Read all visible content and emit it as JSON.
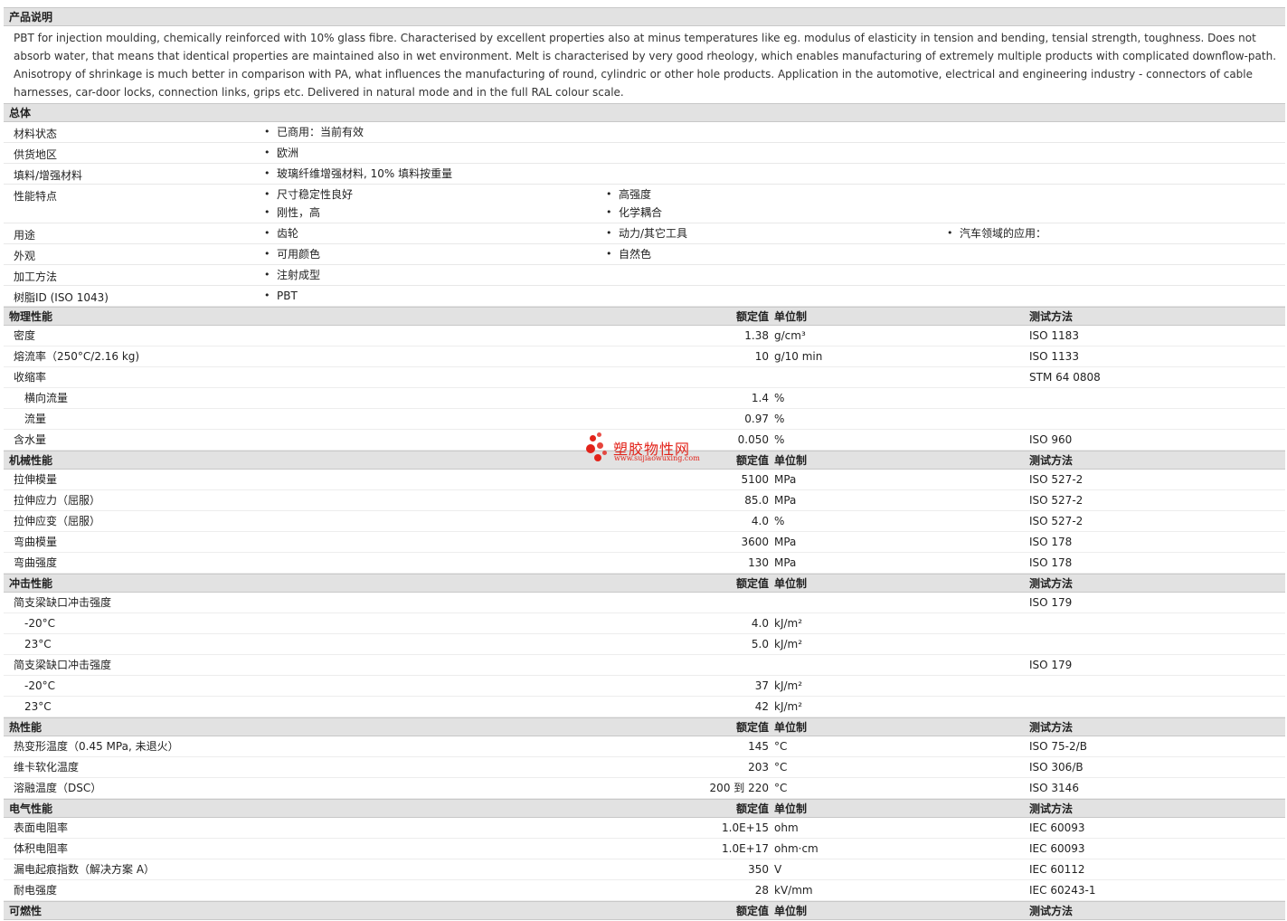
{
  "sections": {
    "desc_title": "产品说明",
    "general": "总体",
    "physical": "物理性能",
    "mechanical": "机械性能",
    "impact": "冲击性能",
    "thermal": "热性能",
    "electrical": "电气性能",
    "cut_off_next": "可燃性"
  },
  "headers": {
    "value": "额定值",
    "unit": "单位制",
    "test": "测试方法"
  },
  "description": "PBT for injection moulding, chemically reinforced with 10% glass fibre. Characterised by excellent properties also at minus temperatures like eg. modulus of elasticity in tension and bending, tensial strength, toughness. Does not absorb water, that means that identical properties are maintained also in wet environment. Melt is characterised by very good rheology, which enables manufacturing of extremely multiple products with complicated downflow-path. Anisotropy of shrinkage is much better in comparison with PA, what influences the manufacturing of round, cylindric or other hole products. Application in the automotive, electrical and engineering industry - connectors of cable harnesses, car-door locks, connection links, grips etc. Delivered in natural mode and in the full RAL colour scale.",
  "general": {
    "status": {
      "label": "材料状态",
      "items": [
        "已商用：当前有效"
      ]
    },
    "region": {
      "label": "供货地区",
      "items": [
        "欧洲"
      ]
    },
    "filler": {
      "label": "填料/增强材料",
      "items": [
        "玻璃纤维增强材料, 10% 填料按重量"
      ]
    },
    "features": {
      "label": "性能特点",
      "items": [
        "尺寸稳定性良好",
        "高强度",
        "刚性，高",
        "化学耦合"
      ]
    },
    "uses": {
      "label": "用途",
      "items": [
        "齿轮",
        "动力/其它工具",
        "汽车领域的应用："
      ]
    },
    "appearance": {
      "label": "外观",
      "items": [
        "可用颜色",
        "自然色"
      ]
    },
    "processing": {
      "label": "加工方法",
      "items": [
        "注射成型"
      ]
    },
    "resin": {
      "label": "树脂ID (ISO 1043)",
      "items": [
        "PBT"
      ]
    }
  },
  "physical": [
    {
      "label": "密度",
      "value": "1.38",
      "unit": "g/cm³",
      "test": "ISO 1183"
    },
    {
      "label": "熔流率（250°C/2.16 kg)",
      "value": "10",
      "unit": "g/10 min",
      "test": "ISO 1133"
    },
    {
      "label": "收缩率",
      "value": "",
      "unit": "",
      "test": "STM 64 0808"
    },
    {
      "label": "横向流量",
      "value": "1.4",
      "unit": "%",
      "test": ""
    },
    {
      "label": "流量",
      "value": "0.97",
      "unit": "%",
      "test": ""
    },
    {
      "label": "含水量",
      "value": "0.050",
      "unit": "%",
      "test": "ISO 960"
    }
  ],
  "mechanical": [
    {
      "label": "拉伸模量",
      "value": "5100",
      "unit": "MPa",
      "test": "ISO 527-2"
    },
    {
      "label": "拉伸应力（屈服）",
      "value": "85.0",
      "unit": "MPa",
      "test": "ISO 527-2"
    },
    {
      "label": "拉伸应变（屈服）",
      "value": "4.0",
      "unit": "%",
      "test": "ISO 527-2"
    },
    {
      "label": "弯曲模量",
      "value": "3600",
      "unit": "MPa",
      "test": "ISO 178"
    },
    {
      "label": "弯曲强度",
      "value": "130",
      "unit": "MPa",
      "test": "ISO 178"
    }
  ],
  "impact": [
    {
      "label": "简支梁缺口冲击强度",
      "value": "",
      "unit": "",
      "test": "ISO 179"
    },
    {
      "label": "-20°C",
      "value": "4.0",
      "unit": "kJ/m²",
      "test": ""
    },
    {
      "label": "23°C",
      "value": "5.0",
      "unit": "kJ/m²",
      "test": ""
    },
    {
      "label": "简支梁缺口冲击强度",
      "value": "",
      "unit": "",
      "test": "ISO 179"
    },
    {
      "label": "-20°C",
      "value": "37",
      "unit": "kJ/m²",
      "test": ""
    },
    {
      "label": "23°C",
      "value": "42",
      "unit": "kJ/m²",
      "test": ""
    }
  ],
  "thermal": [
    {
      "label": "热变形温度（0.45 MPa, 未退火）",
      "value": "145",
      "unit": "°C",
      "test": "ISO 75-2/B"
    },
    {
      "label": "维卡软化温度",
      "value": "203",
      "unit": "°C",
      "test": "ISO 306/B"
    },
    {
      "label": "溶融温度（DSC）",
      "value": "200 到  220",
      "unit": "°C",
      "test": "ISO 3146"
    }
  ],
  "electrical": [
    {
      "label": "表面电阻率",
      "value": "1.0E+15",
      "unit": "ohm",
      "test": "IEC 60093"
    },
    {
      "label": "体积电阻率",
      "value": "1.0E+17",
      "unit": "ohm·cm",
      "test": "IEC 60093"
    },
    {
      "label": "漏电起痕指数（解决方案  A）",
      "value": "350",
      "unit": "V",
      "test": "IEC 60112"
    },
    {
      "label": "耐电强度",
      "value": "28",
      "unit": "kV/mm",
      "test": "IEC 60243-1"
    }
  ],
  "watermark": {
    "name": "塑胶物性网",
    "url": "www.sujiaowuxing.com",
    "color": "#e2231a"
  }
}
